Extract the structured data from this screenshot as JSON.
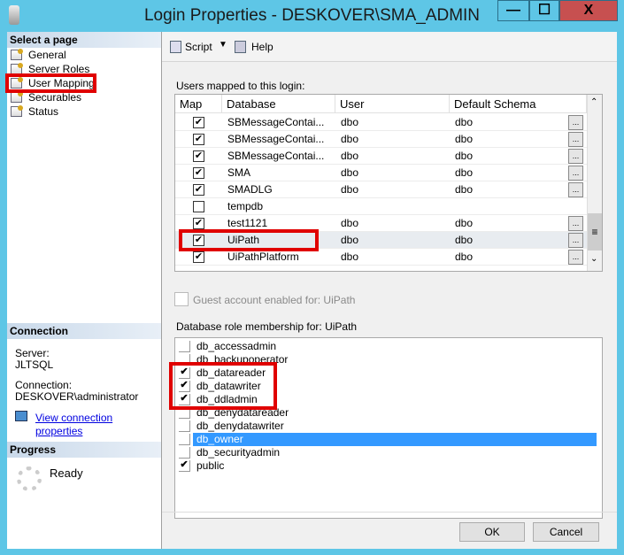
{
  "window": {
    "title": "Login Properties - DESKOVER\\SMA_ADMIN",
    "minimize": "—",
    "maximize": "☐",
    "close": "X"
  },
  "sidebar": {
    "header": "Select a page",
    "items": [
      {
        "label": "General"
      },
      {
        "label": "Server Roles"
      },
      {
        "label": "User Mapping"
      },
      {
        "label": "Securables"
      },
      {
        "label": "Status"
      }
    ],
    "connection": {
      "header": "Connection",
      "server_label": "Server:",
      "server": "JLTSQL",
      "connection_label": "Connection:",
      "connection": "DESKOVER\\administrator",
      "link": "View connection properties"
    },
    "progress": {
      "header": "Progress",
      "status": "Ready"
    }
  },
  "toolbar": {
    "script": "Script",
    "help": "Help"
  },
  "mapping": {
    "label": "Users mapped to this login:",
    "columns": [
      "Map",
      "Database",
      "User",
      "Default Schema"
    ],
    "rows": [
      {
        "map": true,
        "database": "SBMessageContai...",
        "user": "dbo",
        "schema": "dbo"
      },
      {
        "map": true,
        "database": "SBMessageContai...",
        "user": "dbo",
        "schema": "dbo"
      },
      {
        "map": true,
        "database": "SBMessageContai...",
        "user": "dbo",
        "schema": "dbo"
      },
      {
        "map": true,
        "database": "SMA",
        "user": "dbo",
        "schema": "dbo"
      },
      {
        "map": true,
        "database": "SMADLG",
        "user": "dbo",
        "schema": "dbo"
      },
      {
        "map": false,
        "database": "tempdb",
        "user": "",
        "schema": ""
      },
      {
        "map": true,
        "database": "test1121",
        "user": "dbo",
        "schema": "dbo"
      },
      {
        "map": true,
        "database": "UiPath",
        "user": "dbo",
        "schema": "dbo"
      },
      {
        "map": true,
        "database": "UiPathPlatform",
        "user": "dbo",
        "schema": "dbo"
      }
    ],
    "ellipsis": "..."
  },
  "guest": {
    "label": "Guest account enabled for: UiPath",
    "checked": false
  },
  "roles": {
    "label": "Database role membership for: UiPath",
    "items": [
      {
        "name": "db_accessadmin",
        "checked": false
      },
      {
        "name": "db_backupoperator",
        "checked": false
      },
      {
        "name": "db_datareader",
        "checked": true
      },
      {
        "name": "db_datawriter",
        "checked": true
      },
      {
        "name": "db_ddladmin",
        "checked": true
      },
      {
        "name": "db_denydatareader",
        "checked": false
      },
      {
        "name": "db_denydatawriter",
        "checked": false
      },
      {
        "name": "db_owner",
        "checked": false
      },
      {
        "name": "db_securityadmin",
        "checked": false
      },
      {
        "name": "public",
        "checked": true
      }
    ]
  },
  "buttons": {
    "ok": "OK",
    "cancel": "Cancel"
  }
}
